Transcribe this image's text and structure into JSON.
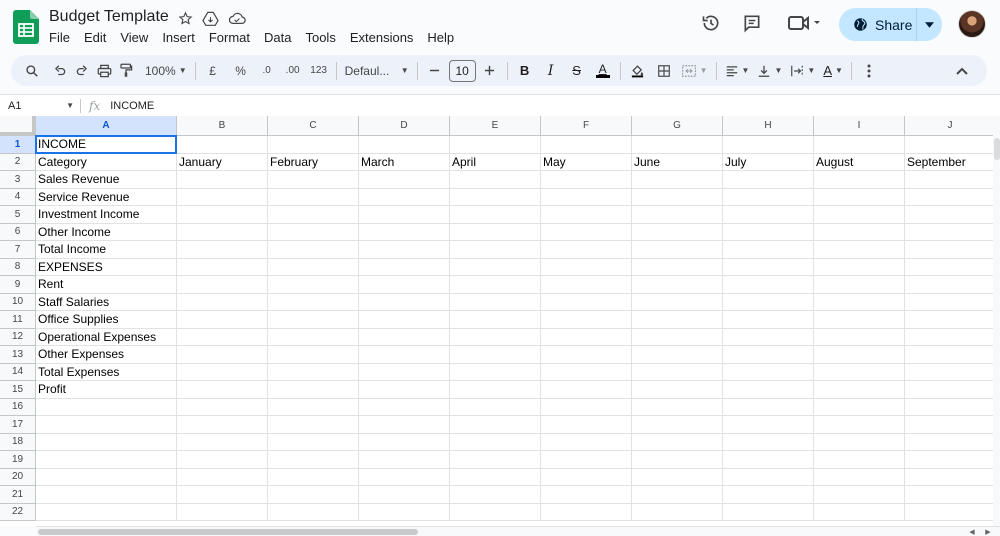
{
  "app": {
    "title": "Budget Template",
    "menu": [
      "File",
      "Edit",
      "View",
      "Insert",
      "Format",
      "Data",
      "Tools",
      "Extensions",
      "Help"
    ],
    "share_label": "Share"
  },
  "toolbar": {
    "zoom": "100%",
    "currency": "£",
    "percent": "%",
    "decrease_decimal": ".0",
    "increase_decimal": ".00",
    "number_format": "123",
    "font": "Defaul...",
    "font_size": "10",
    "bold": "B",
    "italic": "I",
    "strikethrough": "S",
    "text_color_letter": "A",
    "rotate_letter": "A"
  },
  "formula_bar": {
    "cell_ref": "A1",
    "fx": "fx",
    "content": "INCOME"
  },
  "sheet": {
    "columns": [
      "A",
      "B",
      "C",
      "D",
      "E",
      "F",
      "G",
      "H",
      "I",
      "J"
    ],
    "selected_column": "A",
    "selected_row": 1,
    "rows": [
      [
        "INCOME",
        "",
        "",
        "",
        "",
        "",
        "",
        "",
        "",
        ""
      ],
      [
        "Category",
        "January",
        "February",
        "March",
        "April",
        "May",
        "June",
        "July",
        "August",
        "September"
      ],
      [
        "Sales Revenue",
        "",
        "",
        "",
        "",
        "",
        "",
        "",
        "",
        ""
      ],
      [
        "Service Revenue",
        "",
        "",
        "",
        "",
        "",
        "",
        "",
        "",
        ""
      ],
      [
        "Investment Income",
        "",
        "",
        "",
        "",
        "",
        "",
        "",
        "",
        ""
      ],
      [
        "Other Income",
        "",
        "",
        "",
        "",
        "",
        "",
        "",
        "",
        ""
      ],
      [
        "Total Income",
        "",
        "",
        "",
        "",
        "",
        "",
        "",
        "",
        ""
      ],
      [
        "EXPENSES",
        "",
        "",
        "",
        "",
        "",
        "",
        "",
        "",
        ""
      ],
      [
        "Rent",
        "",
        "",
        "",
        "",
        "",
        "",
        "",
        "",
        ""
      ],
      [
        "Staff Salaries",
        "",
        "",
        "",
        "",
        "",
        "",
        "",
        "",
        ""
      ],
      [
        "Office Supplies",
        "",
        "",
        "",
        "",
        "",
        "",
        "",
        "",
        ""
      ],
      [
        "Operational Expenses",
        "",
        "",
        "",
        "",
        "",
        "",
        "",
        "",
        ""
      ],
      [
        "Other Expenses",
        "",
        "",
        "",
        "",
        "",
        "",
        "",
        "",
        ""
      ],
      [
        "Total Expenses",
        "",
        "",
        "",
        "",
        "",
        "",
        "",
        "",
        ""
      ],
      [
        "Profit",
        "",
        "",
        "",
        "",
        "",
        "",
        "",
        "",
        ""
      ],
      [
        "",
        "",
        "",
        "",
        "",
        "",
        "",
        "",
        "",
        ""
      ],
      [
        "",
        "",
        "",
        "",
        "",
        "",
        "",
        "",
        "",
        ""
      ],
      [
        "",
        "",
        "",
        "",
        "",
        "",
        "",
        "",
        "",
        ""
      ],
      [
        "",
        "",
        "",
        "",
        "",
        "",
        "",
        "",
        "",
        ""
      ],
      [
        "",
        "",
        "",
        "",
        "",
        "",
        "",
        "",
        "",
        ""
      ],
      [
        "",
        "",
        "",
        "",
        "",
        "",
        "",
        "",
        "",
        ""
      ],
      [
        "",
        "",
        "",
        "",
        "",
        "",
        "",
        "",
        "",
        ""
      ]
    ]
  },
  "colors": {
    "accent": "#1a73e8",
    "share_bg": "#c2e7ff",
    "header_selected": "#d3e3fd",
    "sheets_green": "#0f9d58"
  },
  "icons": [
    "sheets-logo",
    "star-icon",
    "move-to-drive-icon",
    "cloud-status-icon",
    "history-icon",
    "comments-icon",
    "meet-icon",
    "globe-icon",
    "search-icon",
    "undo-icon",
    "redo-icon",
    "print-icon",
    "paint-format-icon",
    "fill-color-icon",
    "borders-icon",
    "merge-cells-icon",
    "halign-icon",
    "valign-icon",
    "wrap-icon",
    "more-vert-icon",
    "collapse-icon"
  ]
}
